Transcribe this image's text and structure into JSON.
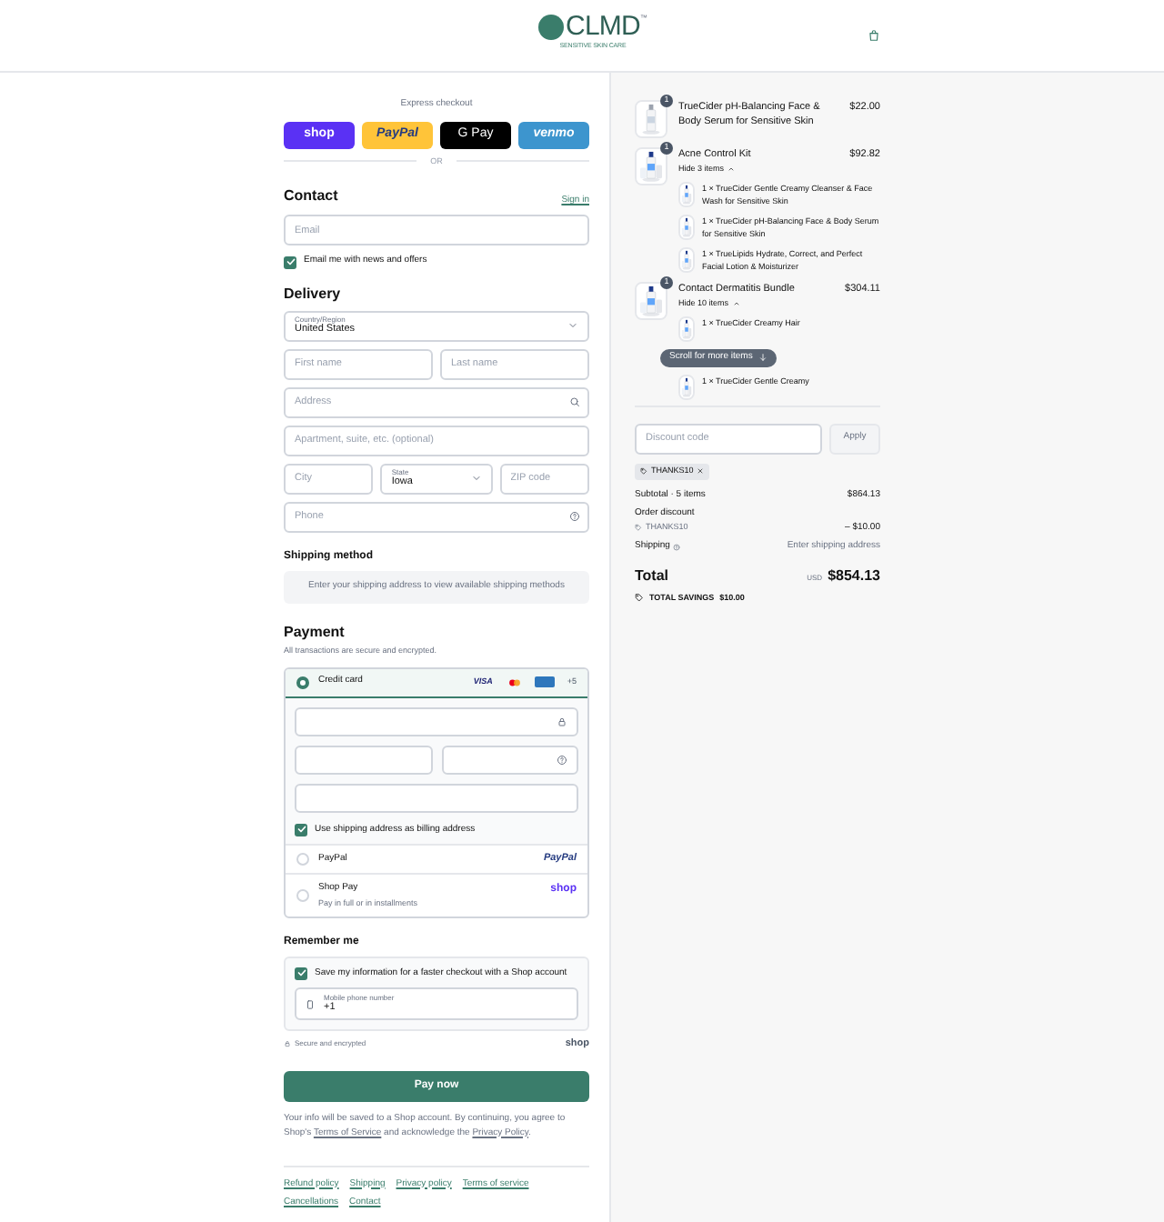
{
  "header": {
    "logo": {
      "letters": "CLMD",
      "mark": "™",
      "tagline": "SENSITIVE SKIN CARE"
    }
  },
  "express": {
    "label": "Express checkout",
    "buttons": [
      {
        "kind": "shop",
        "label": "shop"
      },
      {
        "kind": "paypal",
        "label": "PayPal"
      },
      {
        "kind": "gpay",
        "label": "G Pay"
      },
      {
        "kind": "venmo",
        "label": "venmo"
      }
    ],
    "divider": "OR"
  },
  "contact": {
    "title": "Contact",
    "sign_in": "Sign in",
    "email": {
      "placeholder": "Email"
    },
    "newsletter": {
      "label": "Email me with news and offers",
      "checked": true
    }
  },
  "delivery": {
    "title": "Delivery",
    "rows": [
      [
        {
          "kind": "select",
          "label": "Country/Region",
          "value": "United States"
        }
      ],
      [
        {
          "kind": "text",
          "placeholder": "First name"
        },
        {
          "kind": "text",
          "placeholder": "Last name"
        }
      ],
      [
        {
          "kind": "search",
          "placeholder": "Address"
        }
      ],
      [
        {
          "kind": "text",
          "placeholder": "Apartment, suite, etc. (optional)"
        }
      ],
      [
        {
          "kind": "text",
          "placeholder": "City"
        },
        {
          "kind": "select",
          "label": "State",
          "value": "Iowa"
        },
        {
          "kind": "text",
          "placeholder": "ZIP code"
        }
      ],
      [
        {
          "kind": "help",
          "placeholder": "Phone"
        }
      ]
    ]
  },
  "shipping_method": {
    "title": "Shipping method",
    "message": "Enter your shipping address to view available shipping methods"
  },
  "payment": {
    "title": "Payment",
    "subtitle": "All transactions are secure and encrypted.",
    "methods": [
      {
        "kind": "card",
        "label": "Credit card",
        "selected": true,
        "visa": "VISA",
        "more": "+5",
        "billing": {
          "label": "Use shipping address as billing address",
          "checked": true
        }
      },
      {
        "kind": "paypal",
        "label": "PayPal",
        "selected": false,
        "logo": "PayPal"
      },
      {
        "kind": "shoppay",
        "label": "Shop Pay",
        "sublabel": "Pay in full or in installments",
        "selected": false,
        "logo": "shop"
      }
    ]
  },
  "remember": {
    "title": "Remember me",
    "save": {
      "label": "Save my information for a faster checkout with a Shop account",
      "checked": true
    },
    "phone": {
      "label": "Mobile phone number",
      "value": "+1"
    },
    "secure": "Secure and encrypted",
    "logo": "shop"
  },
  "pay_button": "Pay now",
  "notice": [
    {
      "text": "Your info will be saved to a Shop account. By continuing, you agree to Shop's "
    },
    {
      "link": "Terms of Service"
    },
    {
      "text": " and acknowledge the "
    },
    {
      "link": "Privacy Policy"
    },
    {
      "text": "."
    }
  ],
  "footer_links": [
    "Refund policy",
    "Shipping",
    "Privacy policy",
    "Terms of service",
    "Cancellations",
    "Contact"
  ],
  "cart": {
    "items": [
      {
        "badge": "1",
        "title": "TrueCider pH-Balancing Face & Body Serum for Sensitive Skin",
        "price": "$22.00"
      },
      {
        "badge": "1",
        "title": "Acne Control Kit",
        "price": "$92.82",
        "toggle": "Hide 3 items",
        "expanded": true,
        "children": [
          "1 × TrueCider Gentle Creamy Cleanser & Face Wash for Sensitive Skin",
          "1 × TrueCider pH-Balancing Face & Body Serum for Sensitive Skin",
          "1 × TrueLipids Hydrate, Correct, and Perfect Facial Lotion & Moisturizer"
        ]
      },
      {
        "badge": "1",
        "title": "Contact Dermatitis Bundle",
        "price": "$304.11",
        "toggle": "Hide 10 items",
        "expanded": true,
        "children": [
          "1 × TrueCider Creamy Hair",
          "1 × TrueCider Gentle Creamy"
        ]
      }
    ],
    "scroll_hint": "Scroll for more items",
    "discount": {
      "placeholder": "Discount code",
      "apply": "Apply",
      "tag": "THANKS10"
    },
    "lines": [
      {
        "kind": "plain",
        "label": "Subtotal · 5 items",
        "value": "$864.13"
      },
      {
        "kind": "discount",
        "label": "Order discount",
        "code": "THANKS10",
        "value": "– $10.00"
      },
      {
        "kind": "shipping",
        "label": "Shipping",
        "value": "Enter shipping address"
      }
    ],
    "total": {
      "label": "Total",
      "currency": "USD",
      "value": "$854.13"
    },
    "savings": {
      "label": "TOTAL SAVINGS",
      "value": "$10.00"
    }
  }
}
